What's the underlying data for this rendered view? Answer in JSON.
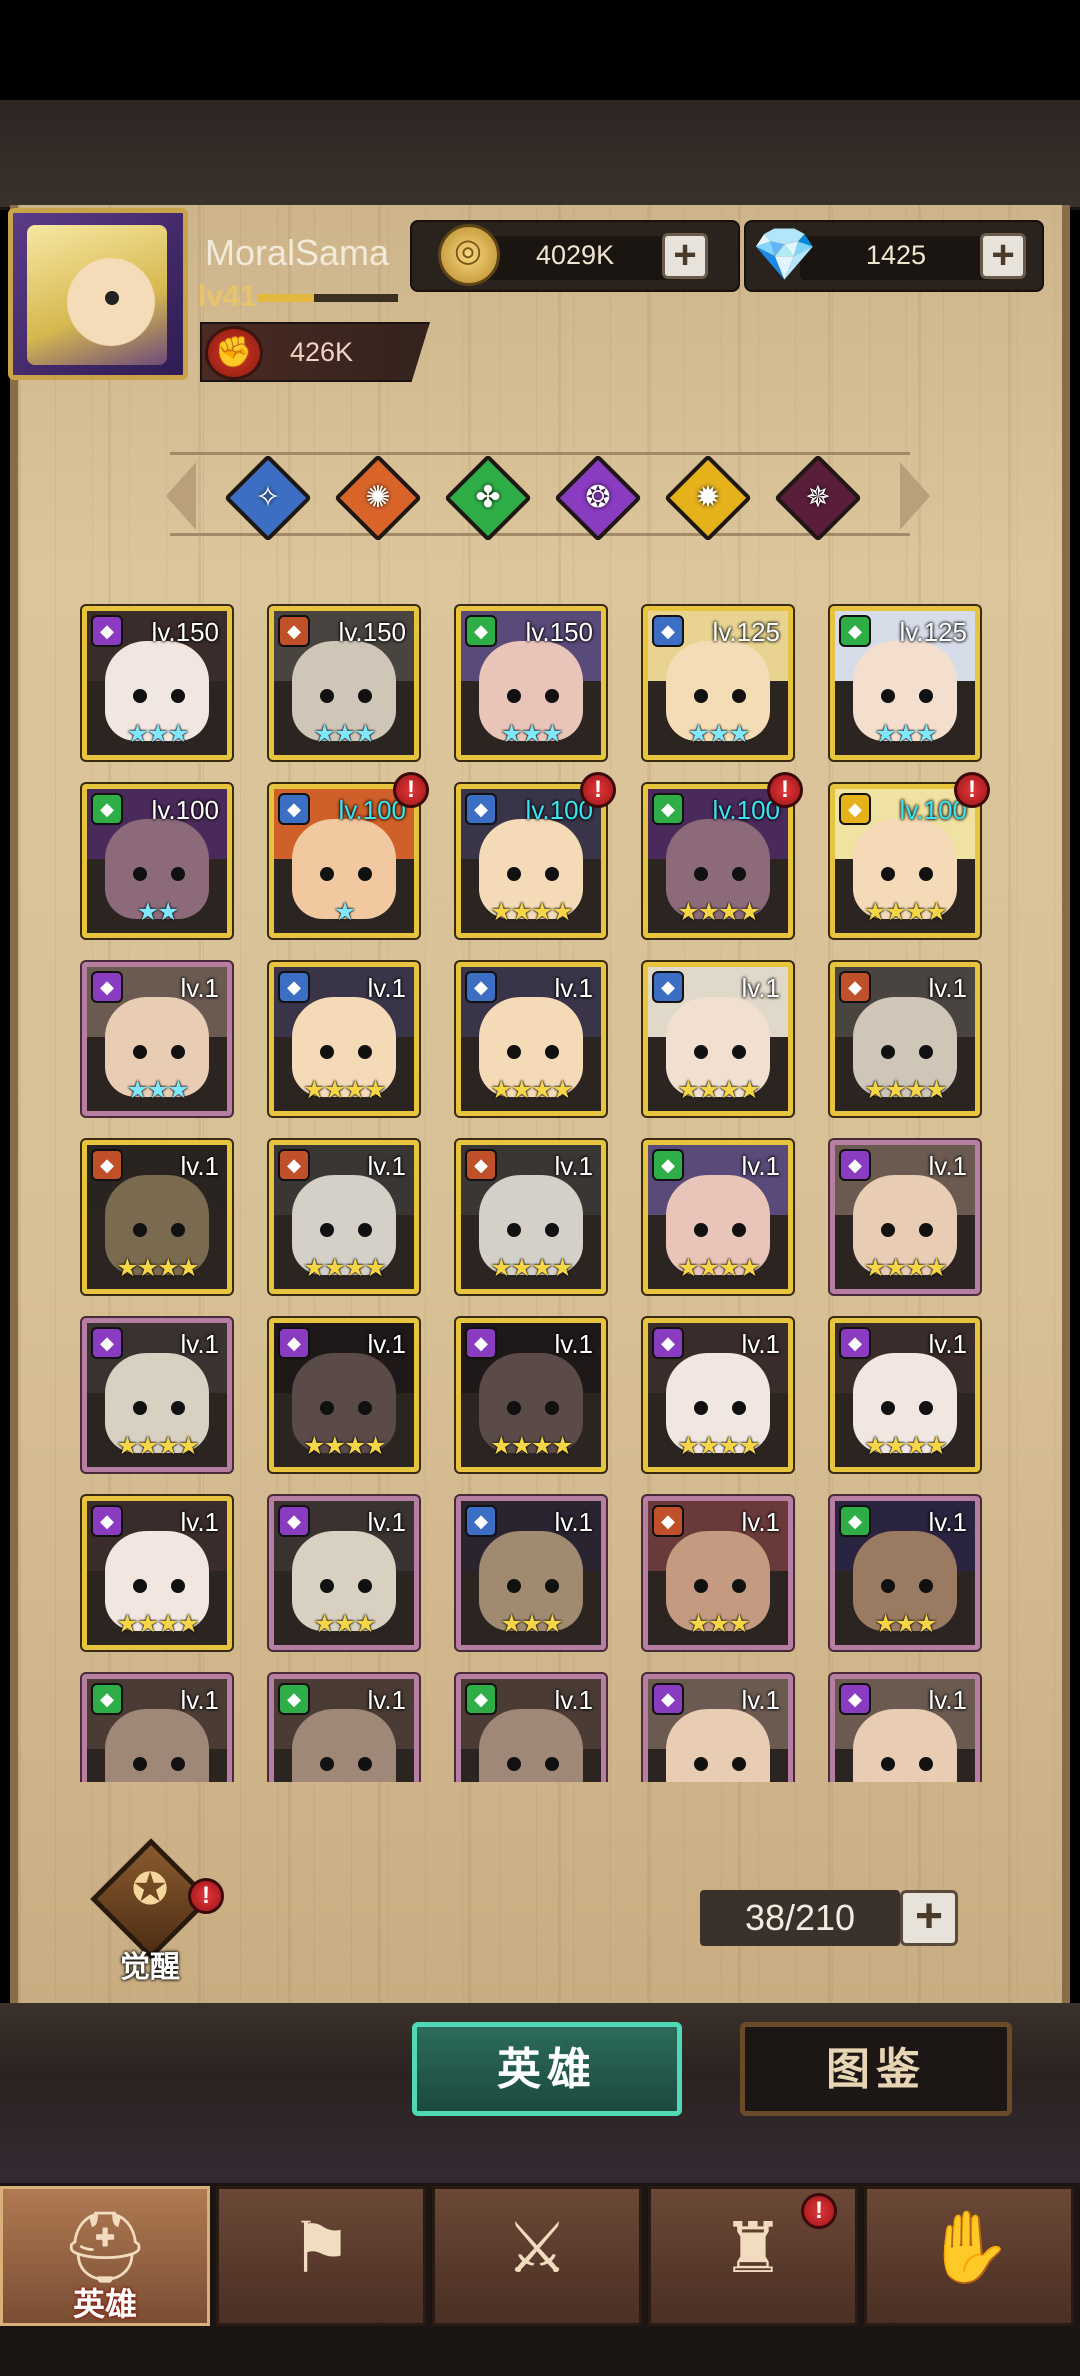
{
  "player": {
    "name": "MoralSama",
    "level": "lv41",
    "power": "426K"
  },
  "resources": {
    "gold": "4029K",
    "diamonds": "1425",
    "add_symbol": "+"
  },
  "element_filters": [
    {
      "name": "light-blue-element-icon",
      "color": "#3c6fc4",
      "glyph": "✧"
    },
    {
      "name": "fire-element-icon",
      "color": "#d8642a",
      "glyph": "✺"
    },
    {
      "name": "nature-element-icon",
      "color": "#2fae48",
      "glyph": "✤"
    },
    {
      "name": "void-element-icon",
      "color": "#8a3cc0",
      "glyph": "❂"
    },
    {
      "name": "sun-element-icon",
      "color": "#e5b21c",
      "glyph": "✹"
    },
    {
      "name": "shadow-element-icon",
      "color": "#5a1e3a",
      "glyph": "✵"
    }
  ],
  "heroes": [
    {
      "lvl": "lv.150",
      "stars": "★★★",
      "star_color": "blue",
      "cls": "#8a3cc0",
      "skin": "#f1e6e0",
      "hood": "#3a2c2a",
      "frame": "gold",
      "alert": false,
      "lvl_color": "white"
    },
    {
      "lvl": "lv.150",
      "stars": "★★★",
      "star_color": "blue",
      "cls": "#c0502a",
      "skin": "#cfc6b8",
      "hood": "#4a4440",
      "frame": "gold",
      "alert": false,
      "lvl_color": "white"
    },
    {
      "lvl": "lv.150",
      "stars": "★★★",
      "star_color": "blue",
      "cls": "#2fae48",
      "skin": "#e9c4b8",
      "hood": "#5a4a7a",
      "frame": "gold",
      "alert": false,
      "lvl_color": "white"
    },
    {
      "lvl": "lv.125",
      "stars": "★★★",
      "star_color": "blue",
      "cls": "#3c6fc4",
      "skin": "#f4ddb6",
      "hood": "#e8d490",
      "frame": "gold",
      "alert": false,
      "lvl_color": "white"
    },
    {
      "lvl": "lv.125",
      "stars": "★★★",
      "star_color": "blue",
      "cls": "#2fae48",
      "skin": "#f4dfcf",
      "hood": "#d6dce8",
      "frame": "gold",
      "alert": false,
      "lvl_color": "white"
    },
    {
      "lvl": "lv.100",
      "stars": "★★",
      "star_color": "blue",
      "cls": "#2fae48",
      "skin": "#8c6a7a",
      "hood": "#4a2a5a",
      "frame": "gold",
      "alert": false,
      "lvl_color": "white"
    },
    {
      "lvl": "lv.100",
      "stars": "★",
      "star_color": "blue",
      "cls": "#3c6fc4",
      "skin": "#f2c8a0",
      "hood": "#d0602a",
      "frame": "gold",
      "alert": true,
      "lvl_color": "cyan"
    },
    {
      "lvl": "lv.100",
      "stars": "★★★★",
      "star_color": "gold",
      "cls": "#3c6fc4",
      "skin": "#f4dab6",
      "hood": "#3a3448",
      "frame": "gold",
      "alert": true,
      "lvl_color": "cyan"
    },
    {
      "lvl": "lv.100",
      "stars": "★★★★",
      "star_color": "gold",
      "cls": "#2fae48",
      "skin": "#8c6a7a",
      "hood": "#4a2a5a",
      "frame": "gold",
      "alert": true,
      "lvl_color": "cyan"
    },
    {
      "lvl": "lv.100",
      "stars": "★★★★",
      "star_color": "gold",
      "cls": "#e5b21c",
      "skin": "#f4dab6",
      "hood": "#f0e2a0",
      "frame": "gold",
      "alert": true,
      "lvl_color": "cyan"
    },
    {
      "lvl": "lv.1",
      "stars": "★★★",
      "star_color": "blue",
      "cls": "#8a3cc0",
      "skin": "#e8ccb4",
      "hood": "#6a5a50",
      "frame": "purple",
      "alert": false,
      "lvl_color": "white"
    },
    {
      "lvl": "lv.1",
      "stars": "★★★★",
      "star_color": "gold",
      "cls": "#3c6fc4",
      "skin": "#f4dab6",
      "hood": "#3a3448",
      "frame": "gold",
      "alert": false,
      "lvl_color": "white"
    },
    {
      "lvl": "lv.1",
      "stars": "★★★★",
      "star_color": "gold",
      "cls": "#3c6fc4",
      "skin": "#f4dab6",
      "hood": "#3a3448",
      "frame": "gold",
      "alert": false,
      "lvl_color": "white"
    },
    {
      "lvl": "lv.1",
      "stars": "★★★★",
      "star_color": "gold",
      "cls": "#3c6fc4",
      "skin": "#f1e0d0",
      "hood": "#e0d8c8",
      "frame": "gold",
      "alert": false,
      "lvl_color": "white"
    },
    {
      "lvl": "lv.1",
      "stars": "★★★★",
      "star_color": "gold",
      "cls": "#c0502a",
      "skin": "#cfc6b8",
      "hood": "#4a4440",
      "frame": "gold",
      "alert": false,
      "lvl_color": "white"
    },
    {
      "lvl": "lv.1",
      "stars": "★★★★",
      "star_color": "gold",
      "cls": "#c0502a",
      "skin": "#7a6a50",
      "hood": "#2a2420",
      "frame": "gold",
      "alert": false,
      "lvl_color": "white"
    },
    {
      "lvl": "lv.1",
      "stars": "★★★★",
      "star_color": "gold",
      "cls": "#c0502a",
      "skin": "#d4d0c8",
      "hood": "#3a3634",
      "frame": "gold",
      "alert": false,
      "lvl_color": "white"
    },
    {
      "lvl": "lv.1",
      "stars": "★★★★",
      "star_color": "gold",
      "cls": "#c0502a",
      "skin": "#d4d0c8",
      "hood": "#3a3634",
      "frame": "gold",
      "alert": false,
      "lvl_color": "white"
    },
    {
      "lvl": "lv.1",
      "stars": "★★★★",
      "star_color": "gold",
      "cls": "#2fae48",
      "skin": "#e9c4b8",
      "hood": "#5a4a7a",
      "frame": "gold",
      "alert": false,
      "lvl_color": "white"
    },
    {
      "lvl": "lv.1",
      "stars": "★★★★",
      "star_color": "gold",
      "cls": "#8a3cc0",
      "skin": "#e8ccb4",
      "hood": "#6a5a50",
      "frame": "purple",
      "alert": false,
      "lvl_color": "white"
    },
    {
      "lvl": "lv.1",
      "stars": "★★★★",
      "star_color": "gold",
      "cls": "#8a3cc0",
      "skin": "#d8d0c0",
      "hood": "#3a3230",
      "frame": "purple",
      "alert": false,
      "lvl_color": "white"
    },
    {
      "lvl": "lv.1",
      "stars": "★★★★",
      "star_color": "gold",
      "cls": "#8a3cc0",
      "skin": "#5a4a48",
      "hood": "#1e1818",
      "frame": "gold",
      "alert": false,
      "lvl_color": "white"
    },
    {
      "lvl": "lv.1",
      "stars": "★★★★",
      "star_color": "gold",
      "cls": "#8a3cc0",
      "skin": "#5a4a48",
      "hood": "#1e1818",
      "frame": "gold",
      "alert": false,
      "lvl_color": "white"
    },
    {
      "lvl": "lv.1",
      "stars": "★★★★",
      "star_color": "gold",
      "cls": "#8a3cc0",
      "skin": "#f1e6e0",
      "hood": "#3a2c2a",
      "frame": "gold",
      "alert": false,
      "lvl_color": "white"
    },
    {
      "lvl": "lv.1",
      "stars": "★★★★",
      "star_color": "gold",
      "cls": "#8a3cc0",
      "skin": "#f1e6e0",
      "hood": "#3a2c2a",
      "frame": "gold",
      "alert": false,
      "lvl_color": "white"
    },
    {
      "lvl": "lv.1",
      "stars": "★★★★",
      "star_color": "gold",
      "cls": "#8a3cc0",
      "skin": "#f1e6e0",
      "hood": "#3a2c2a",
      "frame": "gold",
      "alert": false,
      "lvl_color": "white"
    },
    {
      "lvl": "lv.1",
      "stars": "★★★",
      "star_color": "gold",
      "cls": "#8a3cc0",
      "skin": "#d8d0c0",
      "hood": "#3a3230",
      "frame": "purple",
      "alert": false,
      "lvl_color": "white"
    },
    {
      "lvl": "lv.1",
      "stars": "★★★",
      "star_color": "gold",
      "cls": "#3c6fc4",
      "skin": "#a08a70",
      "hood": "#2a2430",
      "frame": "purple",
      "alert": false,
      "lvl_color": "white"
    },
    {
      "lvl": "lv.1",
      "stars": "★★★",
      "star_color": "gold",
      "cls": "#c0502a",
      "skin": "#c49a80",
      "hood": "#6a3a3a",
      "frame": "purple",
      "alert": false,
      "lvl_color": "white"
    },
    {
      "lvl": "lv.1",
      "stars": "★★★",
      "star_color": "gold",
      "cls": "#2fae48",
      "skin": "#9a7a60",
      "hood": "#2a2440",
      "frame": "purple",
      "alert": false,
      "lvl_color": "white"
    },
    {
      "lvl": "lv.1",
      "stars": "",
      "star_color": "gold",
      "cls": "#2fae48",
      "skin": "#a08878",
      "hood": "#4a3c34",
      "frame": "purple",
      "alert": false,
      "lvl_color": "white"
    },
    {
      "lvl": "lv.1",
      "stars": "",
      "star_color": "gold",
      "cls": "#2fae48",
      "skin": "#a08878",
      "hood": "#4a3c34",
      "frame": "purple",
      "alert": false,
      "lvl_color": "white"
    },
    {
      "lvl": "lv.1",
      "stars": "",
      "star_color": "gold",
      "cls": "#2fae48",
      "skin": "#a08878",
      "hood": "#4a3c34",
      "frame": "purple",
      "alert": false,
      "lvl_color": "white"
    },
    {
      "lvl": "lv.1",
      "stars": "",
      "star_color": "gold",
      "cls": "#8a3cc0",
      "skin": "#e8ccb4",
      "hood": "#6a5a50",
      "frame": "purple",
      "alert": false,
      "lvl_color": "white"
    },
    {
      "lvl": "lv.1",
      "stars": "",
      "star_color": "gold",
      "cls": "#8a3cc0",
      "skin": "#e8ccb4",
      "hood": "#6a5a50",
      "frame": "purple",
      "alert": false,
      "lvl_color": "white"
    }
  ],
  "awaken": {
    "label": "觉醒",
    "glyph": "✪"
  },
  "roster": {
    "count": "38/210"
  },
  "tabs": {
    "heroes": "英雄",
    "codex": "图鉴"
  },
  "nav": [
    {
      "label": "英雄",
      "glyph": "⛑",
      "icon": "hero-helmet-icon",
      "active": true,
      "alert": false
    },
    {
      "label": "",
      "glyph": "⚑",
      "icon": "guild-banner-icon",
      "active": false,
      "alert": false
    },
    {
      "label": "",
      "glyph": "⚔",
      "icon": "battle-crossed-swords-icon",
      "active": false,
      "alert": false
    },
    {
      "label": "",
      "glyph": "♜",
      "icon": "castle-tower-icon",
      "active": false,
      "alert": true
    },
    {
      "label": "",
      "glyph": "✋",
      "icon": "alliance-handshake-icon",
      "active": false,
      "alert": false
    }
  ],
  "alert_symbol": "!",
  "class_glyph": "◆"
}
